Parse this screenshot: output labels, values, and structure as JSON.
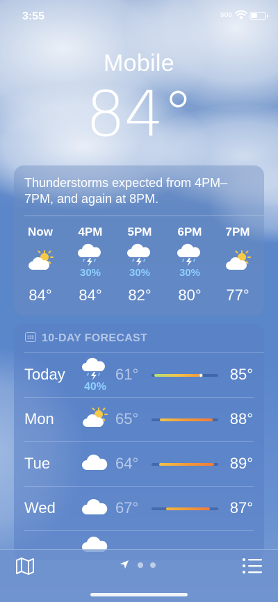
{
  "status": {
    "time": "3:55",
    "sos": "SOS"
  },
  "location": {
    "city": "Mobile",
    "temperature": "84°"
  },
  "hourly": {
    "summary": "Thunderstorms expected from 4PM–7PM, and again at 8PM.",
    "items": [
      {
        "label": "Now",
        "icon": "partly-sunny-icon",
        "chance": "",
        "temp": "84°"
      },
      {
        "label": "4PM",
        "icon": "thunderstorm-icon",
        "chance": "30%",
        "temp": "84°"
      },
      {
        "label": "5PM",
        "icon": "thunderstorm-icon",
        "chance": "30%",
        "temp": "82°"
      },
      {
        "label": "6PM",
        "icon": "thunderstorm-icon",
        "chance": "30%",
        "temp": "80°"
      },
      {
        "label": "7PM",
        "icon": "partly-sunny-icon",
        "chance": "",
        "temp": "77°"
      }
    ]
  },
  "forecast": {
    "header": "10-DAY FORECAST",
    "days": [
      {
        "day": "Today",
        "icon": "thunderstorm-icon",
        "chance": "40%",
        "low": "61°",
        "high": "85°",
        "range_start": 0.04,
        "range_end": 0.74,
        "current": 0.74,
        "colors": [
          "#b4e07a",
          "#f2c44a",
          "#f39a3a"
        ]
      },
      {
        "day": "Mon",
        "icon": "partly-sunny-icon",
        "chance": "",
        "low": "65°",
        "high": "88°",
        "range_start": 0.13,
        "range_end": 0.92,
        "colors": [
          "#f2c44a",
          "#f39a3a",
          "#ef7c3a"
        ]
      },
      {
        "day": "Tue",
        "icon": "cloud-icon",
        "chance": "",
        "low": "64°",
        "high": "89°",
        "range_start": 0.11,
        "range_end": 0.94,
        "colors": [
          "#f2c44a",
          "#f39a3a",
          "#ef7c3a"
        ]
      },
      {
        "day": "Wed",
        "icon": "cloud-icon",
        "chance": "",
        "low": "67°",
        "high": "87°",
        "range_start": 0.22,
        "range_end": 0.88,
        "colors": [
          "#f5b640",
          "#f39a3a",
          "#ef7c3a"
        ]
      }
    ]
  },
  "colors": {
    "precip": "#8fd0ff",
    "sun": "#f7c948"
  }
}
